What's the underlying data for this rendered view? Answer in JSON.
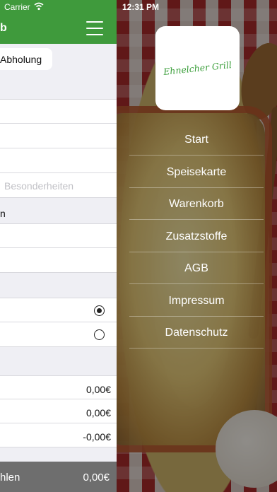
{
  "left": {
    "status": {
      "carrier": "Carrier"
    },
    "nav": {
      "title": "b"
    },
    "segment": {
      "label": "Abholung"
    },
    "fields": {
      "notes_placeholder": "Besonderheiten",
      "row_label": "n"
    },
    "prices": [
      "0,00€",
      "0,00€",
      "-0,00€"
    ],
    "footer": {
      "label": "hlen",
      "total": "0,00€"
    }
  },
  "right": {
    "status_time": "12:31 PM",
    "logo_text": "Ehnelcher Grill",
    "menu": [
      "Start",
      "Speisekarte",
      "Warenkorb",
      "Zusatzstoffe",
      "AGB",
      "Impressum",
      "Datenschutz"
    ]
  },
  "colors": {
    "brand_green": "#3f9a3c",
    "footer_gray": "#6e6e6e"
  }
}
